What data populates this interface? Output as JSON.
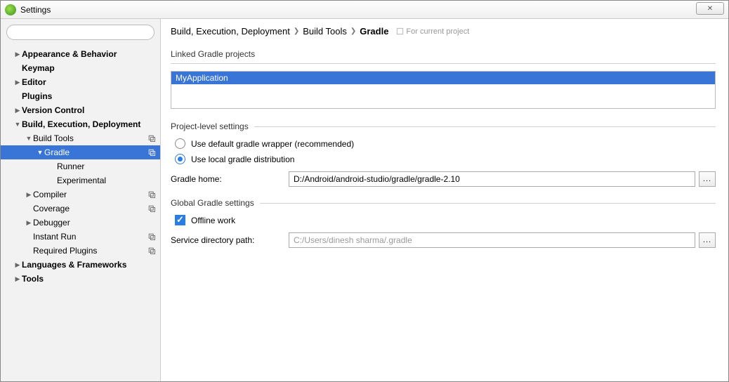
{
  "window": {
    "title": "Settings",
    "close": "✕"
  },
  "search": {
    "placeholder": ""
  },
  "sidebar": {
    "items": [
      {
        "label": "Appearance & Behavior",
        "depth": 0,
        "exp": "right",
        "bold": true
      },
      {
        "label": "Keymap",
        "depth": 0,
        "bold": true
      },
      {
        "label": "Editor",
        "depth": 0,
        "exp": "right",
        "bold": true
      },
      {
        "label": "Plugins",
        "depth": 0,
        "bold": true
      },
      {
        "label": "Version Control",
        "depth": 0,
        "exp": "right",
        "bold": true
      },
      {
        "label": "Build, Execution, Deployment",
        "depth": 0,
        "exp": "down",
        "bold": true
      },
      {
        "label": "Build Tools",
        "depth": 1,
        "exp": "down",
        "copy": true
      },
      {
        "label": "Gradle",
        "depth": 2,
        "exp": "down",
        "copy": true,
        "selected": true
      },
      {
        "label": "Runner",
        "depth": 3
      },
      {
        "label": "Experimental",
        "depth": 3
      },
      {
        "label": "Compiler",
        "depth": 1,
        "exp": "right",
        "copy": true
      },
      {
        "label": "Coverage",
        "depth": 1,
        "copy": true
      },
      {
        "label": "Debugger",
        "depth": 1,
        "exp": "right"
      },
      {
        "label": "Instant Run",
        "depth": 1,
        "copy": true
      },
      {
        "label": "Required Plugins",
        "depth": 1,
        "copy": true
      },
      {
        "label": "Languages & Frameworks",
        "depth": 0,
        "exp": "right",
        "bold": true
      },
      {
        "label": "Tools",
        "depth": 0,
        "exp": "right",
        "bold": true
      }
    ]
  },
  "breadcrumb": {
    "c1": "Build, Execution, Deployment",
    "c2": "Build Tools",
    "c3": "Gradle",
    "scope": "For current project"
  },
  "sections": {
    "linked": "Linked Gradle projects",
    "project_level": "Project-level settings",
    "global": "Global Gradle settings"
  },
  "linkedProjects": {
    "item0": "MyApplication"
  },
  "radios": {
    "default_wrapper": "Use default gradle wrapper (recommended)",
    "local_dist": "Use local gradle distribution"
  },
  "fields": {
    "gradle_home_label": "Gradle home:",
    "gradle_home_value": "D:/Android/android-studio/gradle/gradle-2.10",
    "offline_label": "Offline work",
    "service_dir_label": "Service directory path:",
    "service_dir_value": "C:/Users/dinesh sharma/.gradle",
    "browse": "..."
  }
}
